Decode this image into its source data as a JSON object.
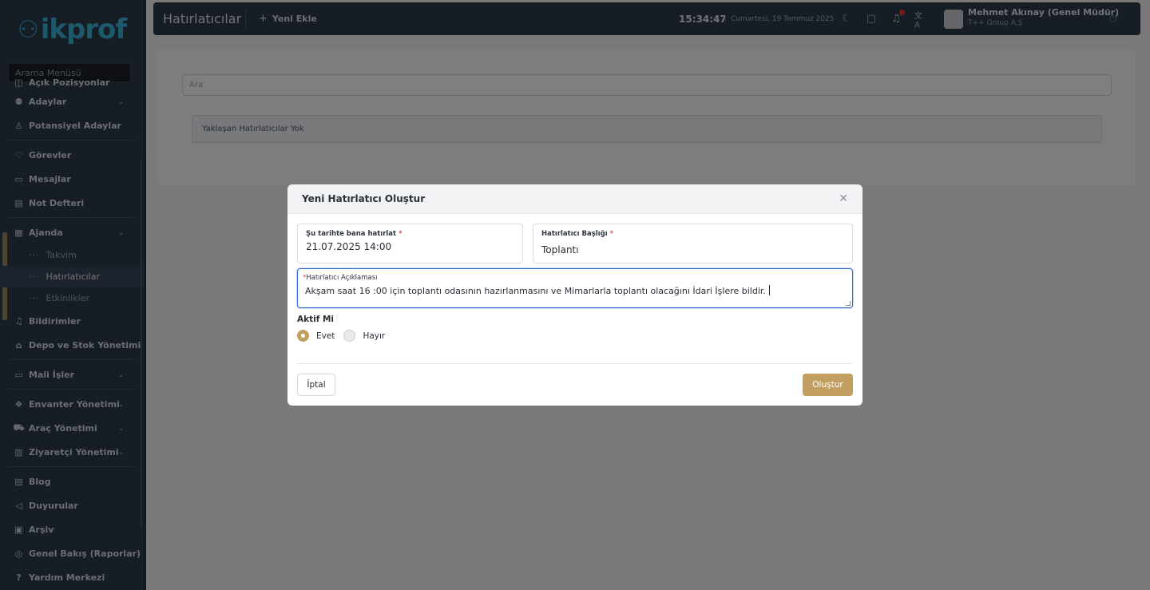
{
  "app": {
    "logo_text": "ikprof"
  },
  "sidebar": {
    "search_placeholder": "Arama Menüsü",
    "items": [
      {
        "label": "Açık Pozisyonlar",
        "icon": "briefcase-icon"
      },
      {
        "label": "Adaylar",
        "icon": "users-icon",
        "has_children": true
      },
      {
        "label": "Potansiyel Adaylar",
        "icon": "user-search-icon"
      },
      {
        "label": "Görevler",
        "icon": "heart-icon"
      },
      {
        "label": "Mesajlar",
        "icon": "messages-icon"
      },
      {
        "label": "Not Defteri",
        "icon": "notebook-icon"
      },
      {
        "label": "Ajanda",
        "icon": "calendar-icon",
        "has_children": true
      },
      {
        "label": "Bildirimler",
        "icon": "bell-icon"
      },
      {
        "label": "Depo ve Stok Yönetimi",
        "icon": "warehouse-icon",
        "has_children": true
      },
      {
        "label": "Mali İşler",
        "icon": "monitor-icon",
        "has_children": true
      },
      {
        "label": "Envanter Yönetimi",
        "icon": "boxes-icon",
        "has_children": true
      },
      {
        "label": "Araç Yönetimi",
        "icon": "car-icon",
        "has_children": true
      },
      {
        "label": "Ziyaretçi Yönetimi",
        "icon": "id-card-icon",
        "has_children": true
      },
      {
        "label": "Blog",
        "icon": "blog-icon"
      },
      {
        "label": "Duyurular",
        "icon": "megaphone-icon"
      },
      {
        "label": "Arşiv",
        "icon": "archive-icon"
      },
      {
        "label": "Genel Bakış (Raporlar)",
        "icon": "eye-chart-icon"
      },
      {
        "label": "Yardım Merkezi",
        "icon": "help-icon"
      }
    ],
    "ajanda_children": [
      {
        "label": "Takvim",
        "active": false
      },
      {
        "label": "Hatırlatıcılar",
        "active": true
      },
      {
        "label": "Etkinlikler",
        "active": false
      }
    ]
  },
  "header": {
    "title": "Hatırlatıcılar",
    "new_button": "Yeni Ekle",
    "time": "15:34:47",
    "date": "Cumartesi, 19 Temmuz 2025",
    "user_name": "Mehmet Akınay (Genel Müdür)",
    "user_company": "T++ Group A.Ş"
  },
  "main": {
    "search_placeholder": "Ara",
    "empty_message": "Yaklaşan Hatırlatıcılar Yok"
  },
  "modal": {
    "title": "Yeni Hatırlatıcı Oluştur",
    "date_label": "Şu tarihte bana hatırlat",
    "date_value": "21.07.2025 14:00",
    "title_label": "Hatırlatıcı Başlığı",
    "title_value": "Toplantı",
    "description_label": "Hatırlatıcı Açıklaması",
    "description_value": "Akşam saat 16 :00 için toplantı odasının hazırlanmasını ve Mimarlarla toplantı olacağını İdari İşlere bildir.",
    "active_label": "Aktif Mi",
    "option_yes": "Evet",
    "option_no": "Hayır",
    "active_selected": "Evet",
    "cancel_button": "İptal",
    "create_button": "Oluştur",
    "required_mark": "*"
  },
  "colors": {
    "sidebar_bg": "#2f3a4b",
    "accent": "#c29e60",
    "focus": "#2f6bd8",
    "required": "#d9534f"
  }
}
